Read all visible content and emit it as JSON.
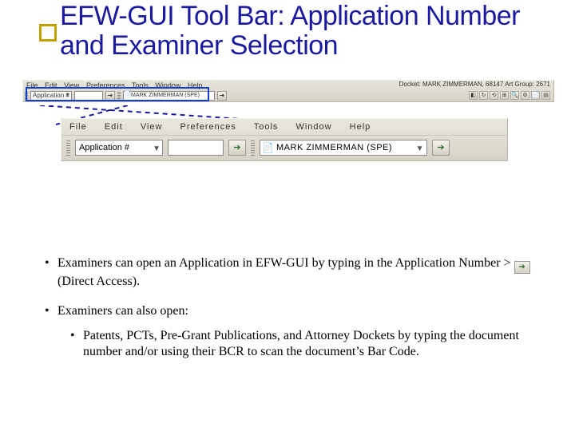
{
  "title": "EFW-GUI Tool Bar: Application Number and Examiner Selection",
  "toolbar_small": {
    "menu": [
      "File",
      "Edit",
      "View",
      "Preferences",
      "Tools",
      "Window",
      "Help"
    ],
    "docket": "Docket: MARK ZIMMERMAN, 68147    Art Group: 2671",
    "combo_label": "Application #",
    "name_value": "MARK ZIMMERMAN (SPE)"
  },
  "toolbar_big": {
    "menu": [
      "File",
      "Edit",
      "View",
      "Preferences",
      "Tools",
      "Window",
      "Help"
    ],
    "combo_label": "Application #",
    "name_value": "MARK ZIMMERMAN (SPE)"
  },
  "bullets": {
    "b1a": "Examiners can open an Application in EFW-GUI by typing in the Application Number > ",
    "b1b": " (Direct Access).",
    "b2": "Examiners can also open:",
    "b2_1": "Patents, PCTs, Pre-Grant Publications, and Attorney Dockets by typing the document number and/or using their BCR to scan the document’s Bar Code."
  },
  "icons": {
    "go": "➔"
  }
}
